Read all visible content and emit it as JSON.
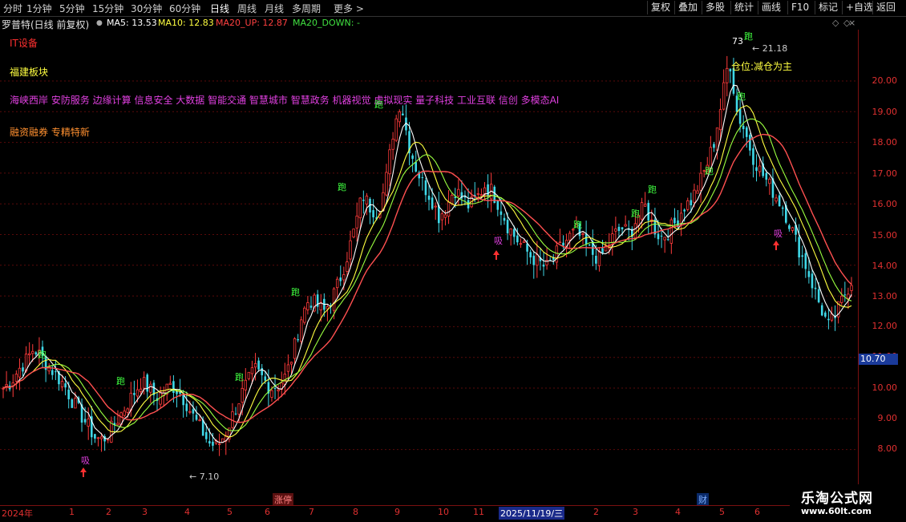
{
  "toolbar": {
    "timeframes": [
      "分时",
      "1分钟",
      "5分钟",
      "15分钟",
      "30分钟",
      "60分钟",
      "日线",
      "周线",
      "月线",
      "多周期",
      "更多 >"
    ],
    "active_timeframe": "日线",
    "buttons": [
      "复权",
      "叠加",
      "多股",
      "统计",
      "画线",
      "F10",
      "标记",
      "+自选",
      "返回"
    ]
  },
  "header": {
    "title": "罗普特(日线 前复权)",
    "ma5": "MA5: 13.53",
    "ma10": "MA10: 12.83",
    "ma20_up": "MA20_UP: 12.87",
    "ma20_down": "MA20_DOWN: -",
    "icons": [
      "diamond-icon",
      "diamond-icon",
      "close-icon"
    ]
  },
  "annotations": {
    "industry": "IT设备",
    "region": "福建板块",
    "concepts": "海峡西岸 安防服务 边缘计算 信息安全 大数据 智能交通 智慧城市 智慧政务 机器视觉 虚拟现实 量子科技 工业互联 信创 多模态AI",
    "attributes": "融资融券 专精特新"
  },
  "signals": {
    "run_label": "跑",
    "buy_label": "吸",
    "position_note": "仓位:减仓为主",
    "high_label": "21.18",
    "high_prefix": "73",
    "low_label": "7.10"
  },
  "price_axis": {
    "ticks": [
      "20.00",
      "19.00",
      "18.00",
      "17.00",
      "16.00",
      "15.00",
      "14.00",
      "13.00",
      "12.00",
      "11.00",
      "10.00",
      "9.00",
      "8.00"
    ],
    "last_price": "10.70"
  },
  "date_axis": {
    "labels": [
      "2024年",
      "1",
      "2",
      "3",
      "4",
      "5",
      "6",
      "7",
      "8",
      "9",
      "10",
      "11",
      "1",
      "2",
      "3",
      "4",
      "5",
      "6"
    ],
    "highlight": "2025/11/19/三"
  },
  "events": {
    "zhangting": "涨停",
    "cai": "财"
  },
  "watermark": {
    "line1": "乐淘公式网",
    "line2": "www.60lt.com"
  },
  "chart_data": {
    "type": "candlestick",
    "ylim": [
      7,
      21.5
    ],
    "close_path": [
      10,
      10.2,
      10.6,
      10.9,
      11.3,
      11.0,
      10.7,
      10.4,
      10.1,
      9.6,
      9.2,
      8.8,
      8.4,
      8.3,
      8.6,
      9.0,
      9.4,
      9.8,
      10.2,
      10.0,
      9.7,
      9.9,
      10.1,
      9.9,
      9.5,
      9.0,
      8.6,
      8.2,
      8.1,
      8.5,
      9.1,
      9.7,
      10.2,
      10.6,
      10.3,
      10.0,
      10.1,
      10.4,
      11.2,
      12.3,
      12.9,
      12.7,
      12.5,
      12.9,
      13.5,
      14.3,
      15.2,
      16.3,
      15.9,
      15.7,
      16.6,
      18.3,
      19.4,
      18.0,
      17.2,
      16.6,
      16.2,
      15.6,
      15.9,
      16.5,
      16.2,
      15.9,
      16.2,
      16.6,
      16.4,
      15.9,
      15.3,
      14.9,
      14.6,
      14.3,
      14.1,
      13.9,
      14.2,
      14.6,
      14.9,
      15.1,
      14.7,
      14.4,
      14.2,
      14.6,
      15.0,
      15.2,
      15.0,
      15.6,
      15.9,
      15.3,
      14.9,
      15.1,
      15.4,
      15.9,
      16.1,
      16.6,
      17.2,
      18.0,
      19.3,
      20.8,
      19.0,
      18.4,
      17.6,
      17.1,
      16.7,
      16.3,
      15.9,
      15.3,
      14.6,
      14.0,
      13.3,
      12.6,
      12.0,
      12.4,
      13.0,
      13.5
    ]
  }
}
